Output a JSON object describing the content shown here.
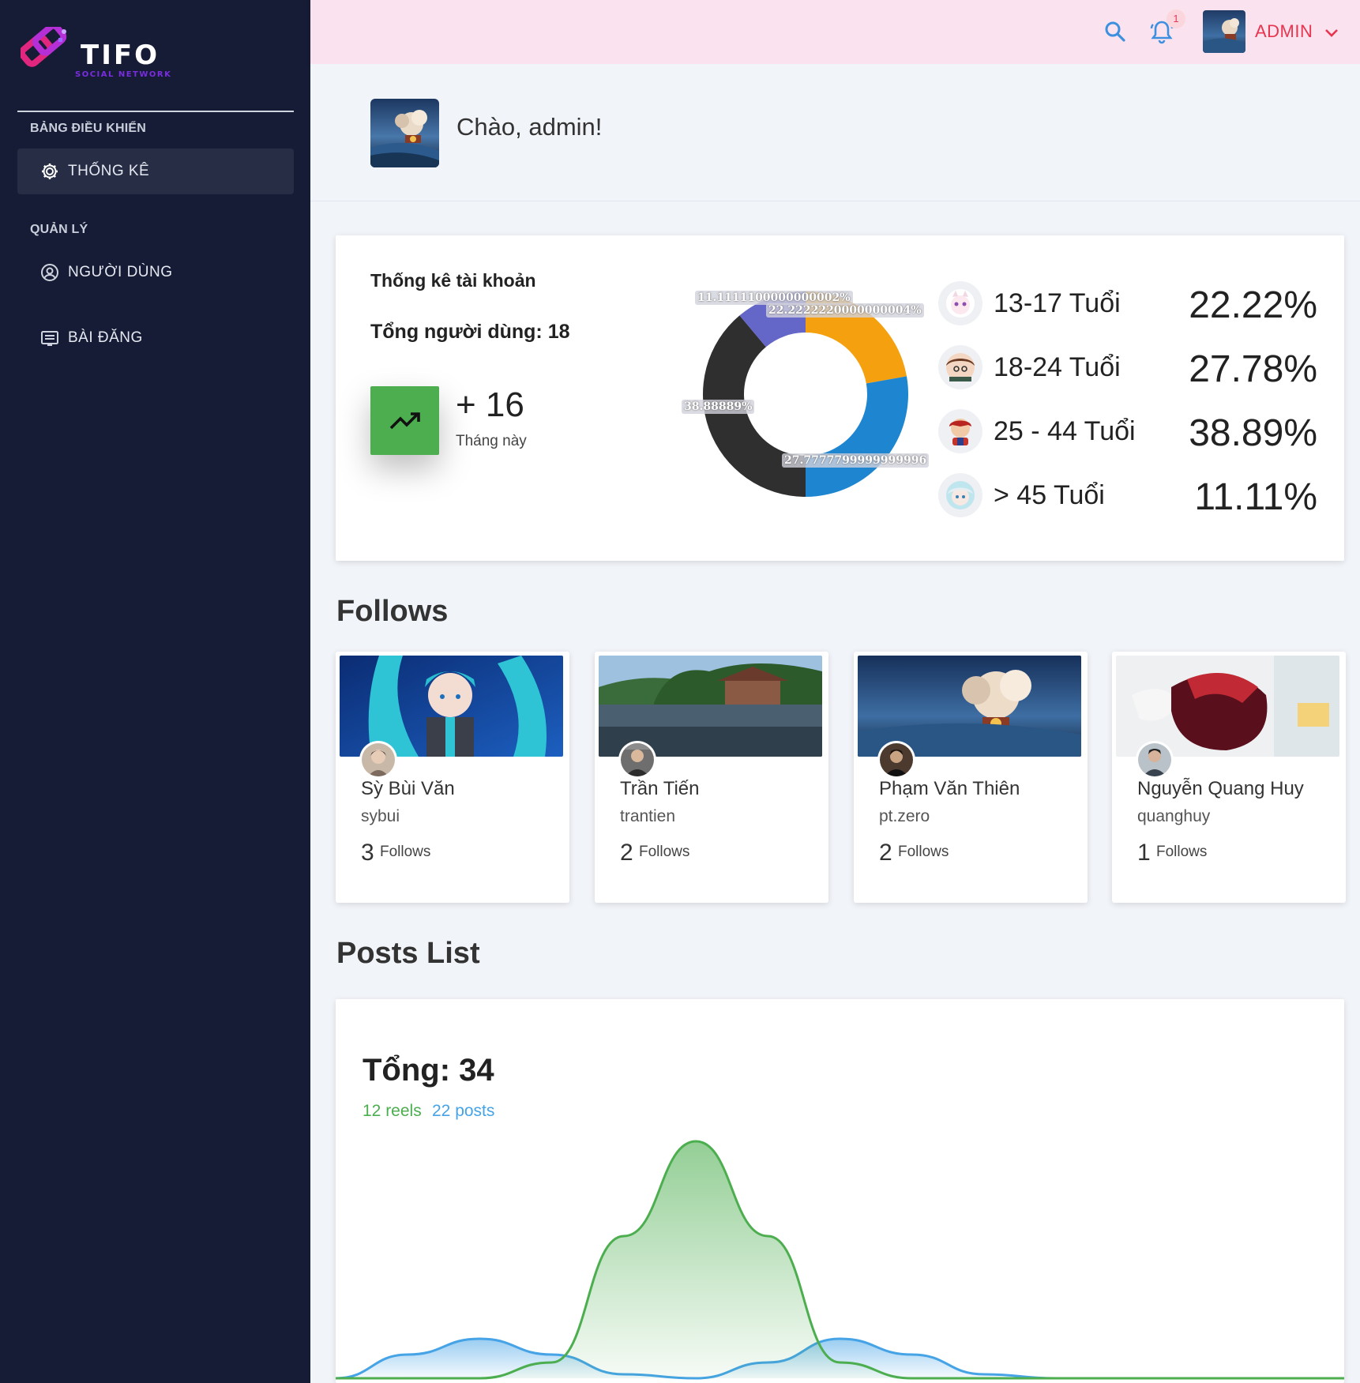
{
  "brand": {
    "name": "TIFO",
    "tagline": "SOCIAL NETWORK",
    "accent": "#e8344f",
    "sidebar_bg": "#161c35"
  },
  "sidebar": {
    "section_dashboard": "BẢNG ĐIỀU KHIỂN",
    "section_manage": "QUẢN LÝ",
    "items": [
      {
        "label": "THỐNG KÊ",
        "icon": "gear-icon",
        "active": true
      },
      {
        "label": "NGƯỜI DÙNG",
        "icon": "user-circle-icon",
        "active": false
      },
      {
        "label": "BÀI ĐĂNG",
        "icon": "post-list-icon",
        "active": false
      }
    ]
  },
  "header": {
    "notification_count": "1",
    "user_name": "ADMIN"
  },
  "welcome": {
    "text": "Chào, admin!"
  },
  "account_stats": {
    "title": "Thống kê tài khoản",
    "total_users": "Tổng người dùng: 18",
    "growth_value": "+ 16",
    "growth_label": "Tháng này",
    "growth_color": "#4cae4f"
  },
  "chart_data": [
    {
      "type": "pie",
      "title": "",
      "donut": true,
      "categories": [
        "13-17 Tuổi",
        "18-24 Tuổi",
        "25 - 44 Tuổi",
        "> 45 Tuổi"
      ],
      "values": [
        22.222222,
        27.777778,
        38.888889,
        11.111111
      ],
      "colors": [
        "#f5a00e",
        "#1e86d0",
        "#2f2f2f",
        "#6466c8"
      ],
      "slice_labels": [
        "22.2222220000000004%",
        "27.7777799999999996",
        "38.88889%",
        "11.1111100000000002%"
      ]
    },
    {
      "type": "area",
      "title": "",
      "series": [
        {
          "name": "reels",
          "color": "#4cae4f",
          "values": [
            0,
            0,
            0,
            0.4,
            3.6,
            6,
            3.6,
            0.4,
            0,
            0,
            0,
            0,
            0,
            0,
            0
          ]
        },
        {
          "name": "posts",
          "color": "#45a3e6",
          "values": [
            0,
            0.6,
            1,
            0.6,
            0.1,
            0,
            0.4,
            1,
            0.6,
            0.1,
            0,
            0,
            0,
            0,
            0
          ]
        }
      ]
    }
  ],
  "age_breakdown": [
    {
      "label": "13-17 Tuổi",
      "percent": "22.22%"
    },
    {
      "label": "18-24 Tuổi",
      "percent": "27.78%"
    },
    {
      "label": "25 - 44 Tuổi",
      "percent": "38.89%"
    },
    {
      "label": "> 45 Tuổi",
      "percent": "11.11%"
    }
  ],
  "follows": {
    "title": "Follows",
    "count_label": "Follows",
    "cards": [
      {
        "name": "Sỳ Bùi Văn",
        "username": "sybui",
        "count": "3"
      },
      {
        "name": "Trần Tiến",
        "username": "trantien",
        "count": "2"
      },
      {
        "name": "Phạm Văn Thiên",
        "username": "pt.zero",
        "count": "2"
      },
      {
        "name": "Nguyễn Quang Huy",
        "username": "quanghuy",
        "count": "1"
      }
    ]
  },
  "posts": {
    "title": "Posts List",
    "total": "Tổng: 34",
    "reels": "12 reels",
    "posts_count": "22 posts"
  }
}
